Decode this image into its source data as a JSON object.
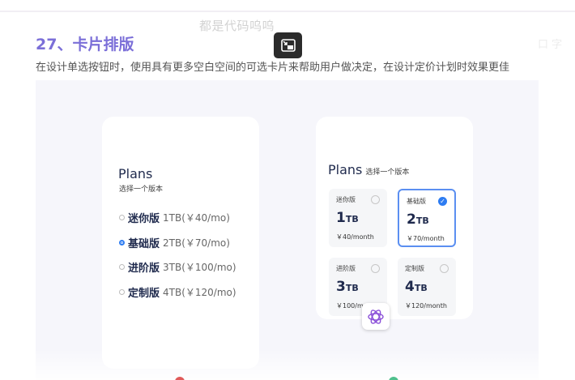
{
  "watermark": "都是代码呜呜",
  "ghost_text": "口 字",
  "section": {
    "title": "27、卡片排版",
    "description": "在设计单选按钮时，使用具有更多空白空间的可选卡片来帮助用户做决定，在设计定价计划时效果更佳"
  },
  "left_card": {
    "title": "Plans",
    "subtitle": "选择一个版本",
    "options": [
      {
        "name": "迷你版",
        "spec": "1TB(￥40/mo)"
      },
      {
        "name": "基础版",
        "spec": "2TB(￥70/mo)"
      },
      {
        "name": "进阶版",
        "spec": "3TB(￥100/mo)"
      },
      {
        "name": "定制版",
        "spec": "4TB(￥120/mo)"
      }
    ]
  },
  "right_card": {
    "title": "Plans",
    "subtitle": "选择一个版本",
    "options": [
      {
        "name": "迷你版",
        "size": "1",
        "unit": "TB",
        "price": "￥40/month"
      },
      {
        "name": "基础版",
        "size": "2",
        "unit": "TB",
        "price": "￥70/month"
      },
      {
        "name": "进阶版",
        "size": "3",
        "unit": "TB",
        "price": "￥100/month"
      },
      {
        "name": "定制版",
        "size": "4",
        "unit": "TB",
        "price": "￥120/month"
      }
    ]
  },
  "colors": {
    "accent_title": "#7b6fd8",
    "selected_blue": "#2d7cf2"
  },
  "icons": [
    "picture-in-picture-icon",
    "ai-assistant-icon",
    "check-icon"
  ]
}
